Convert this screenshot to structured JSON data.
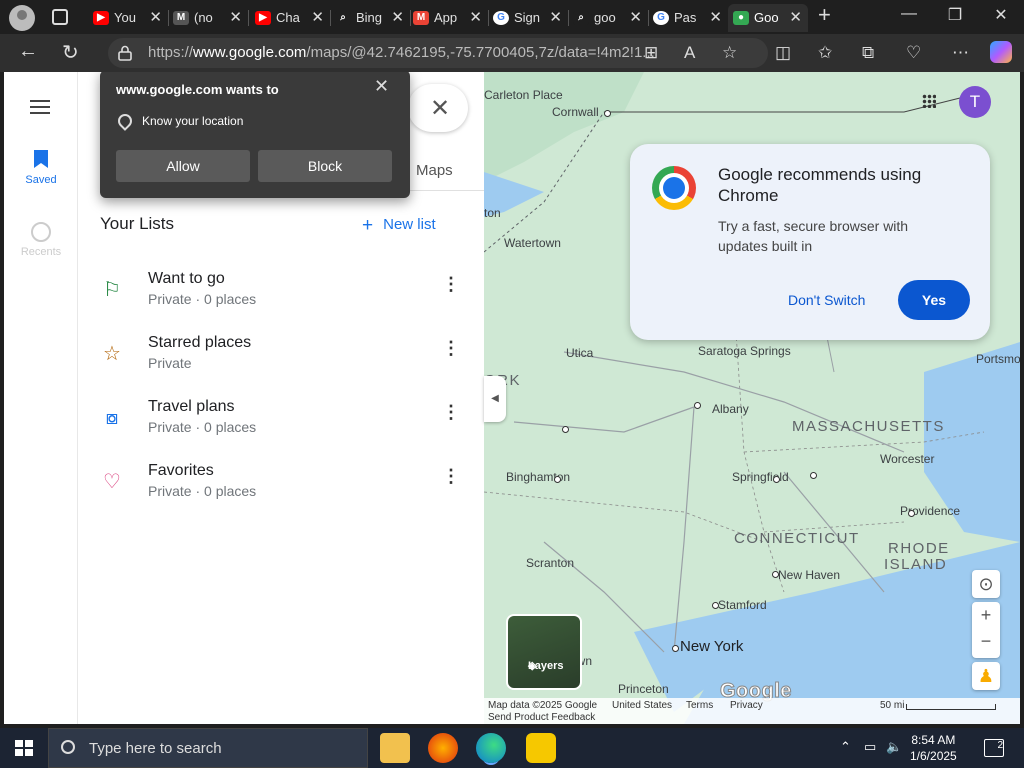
{
  "tabs": [
    {
      "title": "You",
      "fav_color": "#ff0000",
      "fav_glyph": "▶"
    },
    {
      "title": "(no",
      "fav_color": "#555555",
      "fav_glyph": "M"
    },
    {
      "title": "Cha",
      "fav_color": "#ff0000",
      "fav_glyph": "▶"
    },
    {
      "title": "Bing",
      "fav_color": "#1f1f1f",
      "fav_glyph": "⌕"
    },
    {
      "title": "App",
      "fav_color": "#ea4335",
      "fav_glyph": "M"
    },
    {
      "title": "Sign",
      "fav_color": "#ffffff",
      "fav_glyph": "G"
    },
    {
      "title": "goo",
      "fav_color": "#1f1f1f",
      "fav_glyph": "⌕"
    },
    {
      "title": "Pas",
      "fav_color": "#ffffff",
      "fav_glyph": "G"
    },
    {
      "title": "Goo",
      "fav_color": "#34a853",
      "fav_glyph": "●"
    }
  ],
  "address": {
    "prefix": "https://",
    "host": "www.google.com",
    "path": "/maps/@42.7462195,-75.7700405,7z/data=!4m2!1..."
  },
  "permission": {
    "title": "www.google.com wants to",
    "item": "Know your location",
    "allow": "Allow",
    "block": "Block"
  },
  "rail": {
    "saved": "Saved",
    "recents": "Recents"
  },
  "panel": {
    "maps_tab": "Maps",
    "lists_title": "Your Lists",
    "new_list": "New list",
    "lists": [
      {
        "name": "Want to go",
        "sub": "Private · 0 places",
        "icon": "flag-icon",
        "color": "#188038"
      },
      {
        "name": "Starred places",
        "sub": "Private",
        "icon": "star-icon",
        "color": "#b06000"
      },
      {
        "name": "Travel plans",
        "sub": "Private · 0 places",
        "icon": "suitcase-icon",
        "color": "#1a73e8"
      },
      {
        "name": "Favorites",
        "sub": "Private · 0 places",
        "icon": "heart-icon",
        "color": "#d93b7a"
      }
    ]
  },
  "chrome_card": {
    "title": "Google recommends using Chrome",
    "subtitle": "Try a fast, secure browser with updates built in",
    "dont_switch": "Don't Switch",
    "yes": "Yes"
  },
  "avatar_letter": "T",
  "map": {
    "places": [
      {
        "name": "Carleton Place",
        "cls": "ml"
      },
      {
        "name": "Cornwall",
        "cls": "ml"
      },
      {
        "name": "Watertown",
        "cls": "ml"
      },
      {
        "name": "Utica",
        "cls": "ml"
      },
      {
        "name": "Saratoga Springs",
        "cls": "ml"
      },
      {
        "name": "Albany",
        "cls": "ml"
      },
      {
        "name": "MASSACHUSETTS",
        "cls": "ml state"
      },
      {
        "name": "Worcester",
        "cls": "ml"
      },
      {
        "name": "Springfield",
        "cls": "ml"
      },
      {
        "name": "Binghamton",
        "cls": "ml"
      },
      {
        "name": "Providence",
        "cls": "ml"
      },
      {
        "name": "CONNECTICUT",
        "cls": "ml state"
      },
      {
        "name": "RHODE",
        "cls": "ml state"
      },
      {
        "name": "ISLAND",
        "cls": "ml state"
      },
      {
        "name": "New Haven",
        "cls": "ml"
      },
      {
        "name": "Scranton",
        "cls": "ml"
      },
      {
        "name": "Stamford",
        "cls": "ml"
      },
      {
        "name": "New York",
        "cls": "ml big"
      },
      {
        "name": "Princeton",
        "cls": "ml"
      },
      {
        "name": "ORK",
        "cls": "ml state"
      },
      {
        "name": "ton",
        "cls": "ml"
      },
      {
        "name": "own",
        "cls": "ml"
      },
      {
        "name": "Portsmo",
        "cls": "ml"
      }
    ],
    "layers": "Layers",
    "footer": {
      "data": "Map data ©2025 Google",
      "country": "United States",
      "terms": "Terms",
      "privacy": "Privacy",
      "feedback": "Send Product Feedback",
      "scale": "50 mi"
    },
    "logo": "Google"
  },
  "taskbar": {
    "search_placeholder": "Type here to search",
    "time": "8:54 AM",
    "date": "1/6/2025",
    "notif_count": "2"
  }
}
